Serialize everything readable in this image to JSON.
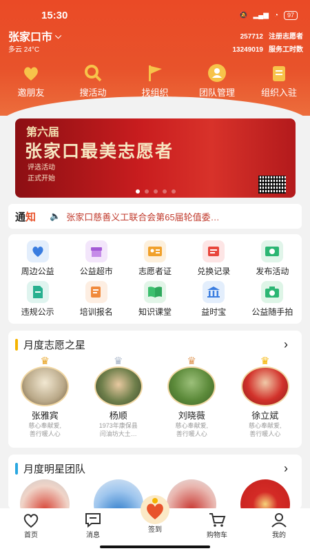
{
  "status": {
    "time": "15:30",
    "battery": "97"
  },
  "header": {
    "city": "张家口市",
    "weather": "多云 24°C",
    "volunteers_num": "257712",
    "volunteers_label": "注册志愿者",
    "hours_num": "13249019",
    "hours_label": "服务工时数"
  },
  "top_nav": [
    {
      "label": "邀朋友",
      "icon": "invite-icon"
    },
    {
      "label": "搜活动",
      "icon": "search-icon"
    },
    {
      "label": "找组织",
      "icon": "flag-icon"
    },
    {
      "label": "团队管理",
      "icon": "team-icon"
    },
    {
      "label": "组织入驻",
      "icon": "clipboard-icon"
    }
  ],
  "banner": {
    "line1": "第六届",
    "line2": "张家口最美志愿者",
    "line3": "评选活动",
    "line4": "正式开始"
  },
  "notice": {
    "tag_a": "通",
    "tag_b": "知",
    "text": "张家口慈善义工联合会第65届轮值委…"
  },
  "grid": [
    {
      "label": "周边公益",
      "icon": "heart-hand-icon",
      "color": "#e3eefc"
    },
    {
      "label": "公益超市",
      "icon": "shop-icon",
      "color": "#f3e6fb"
    },
    {
      "label": "志愿者证",
      "icon": "id-card-icon",
      "color": "#fdf0dc"
    },
    {
      "label": "兑换记录",
      "icon": "ticket-icon",
      "color": "#fde5e5"
    },
    {
      "label": "发布活动",
      "icon": "publish-icon",
      "color": "#e1f5ea"
    },
    {
      "label": "违规公示",
      "icon": "document-icon",
      "color": "#dff4ef"
    },
    {
      "label": "培训报名",
      "icon": "edit-icon",
      "color": "#fdeee2"
    },
    {
      "label": "知识课堂",
      "icon": "book-icon",
      "color": "#e2f5e8"
    },
    {
      "label": "益时宝",
      "icon": "bank-icon",
      "color": "#e3eefc"
    },
    {
      "label": "公益随手拍",
      "icon": "camera-icon",
      "color": "#def5e7"
    }
  ],
  "monthly_star": {
    "title": "月度志愿之星",
    "people": [
      {
        "name": "张雅宾",
        "desc1": "慈心奉献爱,",
        "desc2": "善行暖人心"
      },
      {
        "name": "杨顺",
        "desc1": "1973年康保县",
        "desc2": "闫油坊大土…"
      },
      {
        "name": "刘晓薇",
        "desc1": "慈心奉献爱,",
        "desc2": "善行暖人心"
      },
      {
        "name": "徐立斌",
        "desc1": "慈心奉献爱,",
        "desc2": "善行暖人心"
      }
    ]
  },
  "monthly_team": {
    "title": "月度明星团队"
  },
  "tabbar": [
    {
      "label": "首页",
      "icon": "home-heart-icon"
    },
    {
      "label": "消息",
      "icon": "message-icon"
    },
    {
      "label": "签到",
      "icon": "checkin-icon"
    },
    {
      "label": "购物车",
      "icon": "cart-icon"
    },
    {
      "label": "我的",
      "icon": "profile-icon"
    }
  ],
  "colors": {
    "brand": "#e8532b",
    "star_bar": "#f5b400",
    "team_bar": "#2aa7e0"
  }
}
